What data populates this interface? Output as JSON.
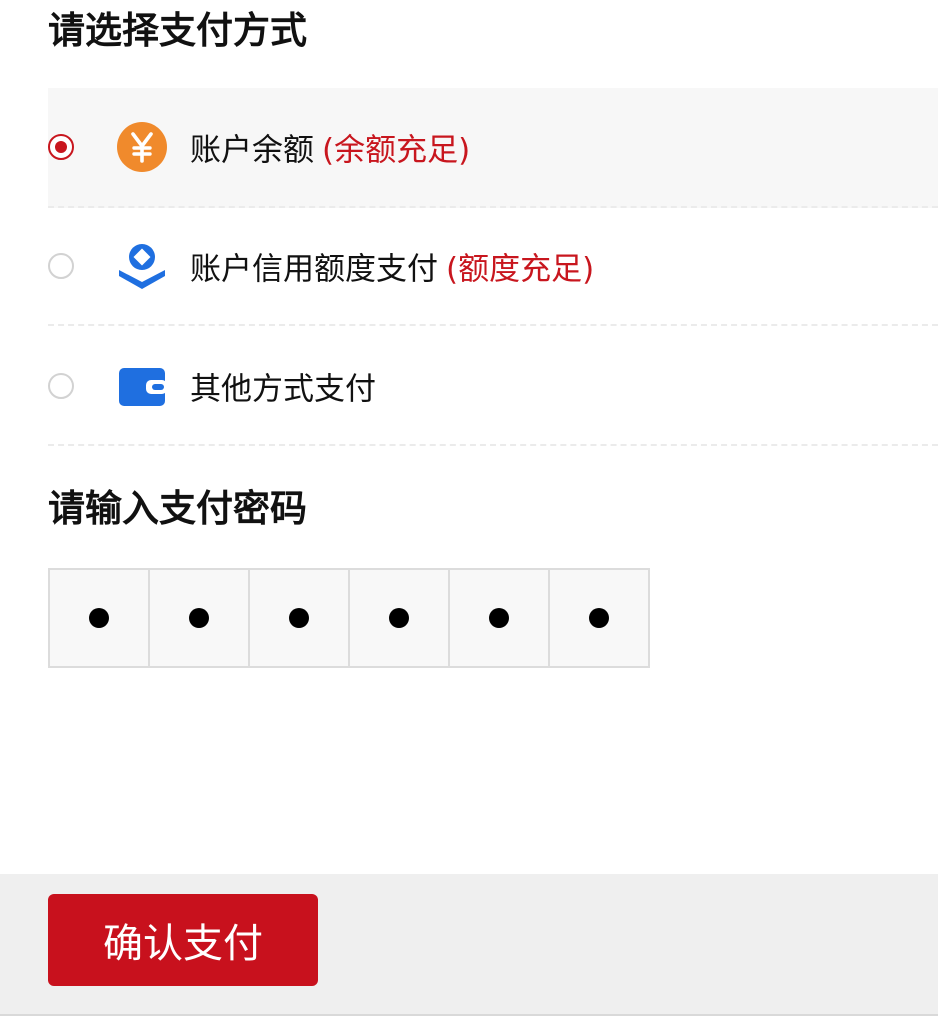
{
  "payment_section": {
    "title": "请选择支付方式",
    "options": [
      {
        "label": "账户余额",
        "note": "(余额充足)",
        "icon": "yuan-coin-icon",
        "selected": true,
        "icon_color": "#f08a2c"
      },
      {
        "label": "账户信用额度支付",
        "note": "(额度充足)",
        "icon": "credit-shield-icon",
        "selected": false,
        "icon_color": "#1f6fe0"
      },
      {
        "label": "其他方式支付",
        "note": "",
        "icon": "wallet-icon",
        "selected": false,
        "icon_color": "#1f6fe0"
      }
    ]
  },
  "password_section": {
    "title": "请输入支付密码",
    "digits_entered": 6,
    "digits_total": 6
  },
  "footer": {
    "confirm_label": "确认支付"
  },
  "colors": {
    "accent": "#c8111d",
    "note_text": "#c8161e"
  }
}
